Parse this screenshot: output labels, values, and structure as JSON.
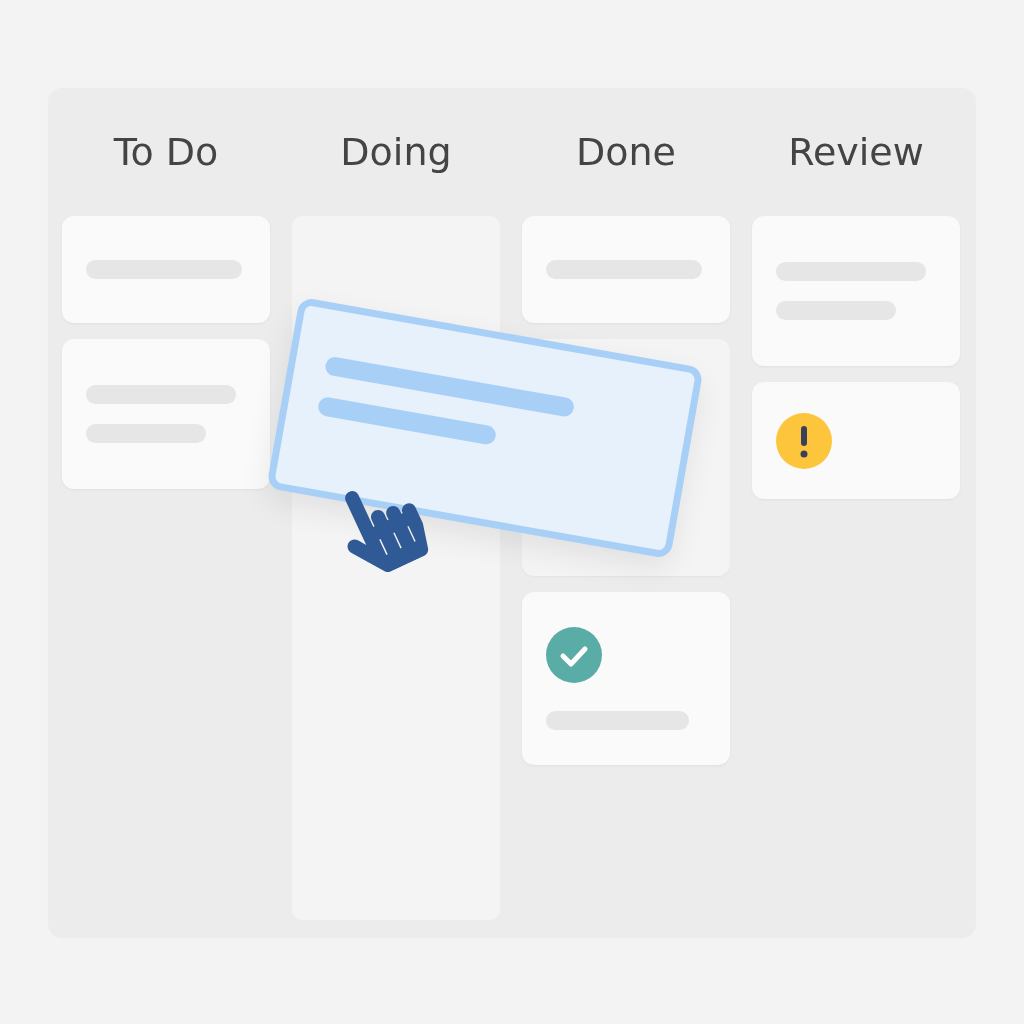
{
  "columns": [
    {
      "title": "To Do",
      "kind": "list",
      "cards": [
        {
          "kind": "one-line"
        },
        {
          "kind": "two-line"
        }
      ]
    },
    {
      "title": "Doing",
      "kind": "drop-zone"
    },
    {
      "title": "Done",
      "kind": "list",
      "cards": [
        {
          "kind": "one-line"
        },
        {
          "kind": "placeholder"
        },
        {
          "kind": "check"
        }
      ]
    },
    {
      "title": "Review",
      "kind": "list",
      "cards": [
        {
          "kind": "two-line"
        },
        {
          "kind": "warning"
        }
      ]
    }
  ],
  "dragged_card": {
    "kind": "two-line"
  }
}
